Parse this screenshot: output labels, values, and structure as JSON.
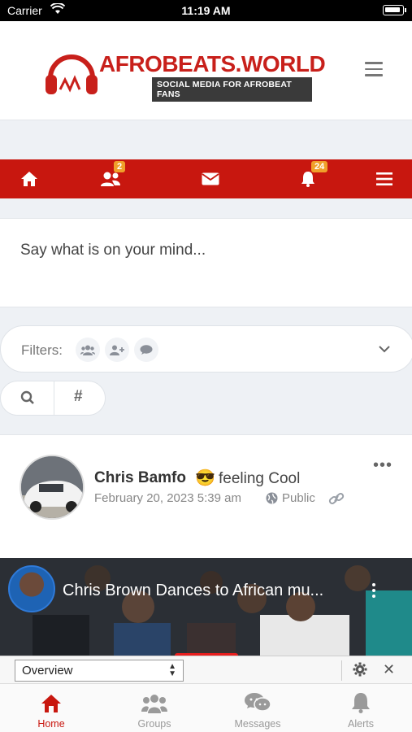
{
  "status_bar": {
    "carrier": "Carrier",
    "time": "11:19 AM"
  },
  "brand": {
    "name": "AFROBEATS.WORLD",
    "tagline": "SOCIAL MEDIA FOR AFROBEAT FANS",
    "accent": "#c8170f"
  },
  "navbar": {
    "items": [
      {
        "icon": "home-icon"
      },
      {
        "icon": "friends-icon",
        "badge": "2"
      },
      {
        "icon": "envelope-icon"
      },
      {
        "icon": "bell-icon",
        "badge": "24"
      },
      {
        "icon": "menu-icon"
      }
    ]
  },
  "composer": {
    "placeholder": "Say what is on your mind..."
  },
  "filters": {
    "label": "Filters:"
  },
  "post": {
    "author": "Chris Bamfo",
    "emoji": "😎",
    "feeling": "feeling Cool",
    "date": "February 20, 2023 5:39 am",
    "privacy": "Public",
    "video_title": "Chris Brown Dances to African mu..."
  },
  "devbar": {
    "select_value": "Overview"
  },
  "tabs": [
    {
      "label": "Home",
      "icon": "home-icon",
      "active": true
    },
    {
      "label": "Groups",
      "icon": "groups-icon"
    },
    {
      "label": "Messages",
      "icon": "chat-icon"
    },
    {
      "label": "Alerts",
      "icon": "bell-icon"
    }
  ]
}
